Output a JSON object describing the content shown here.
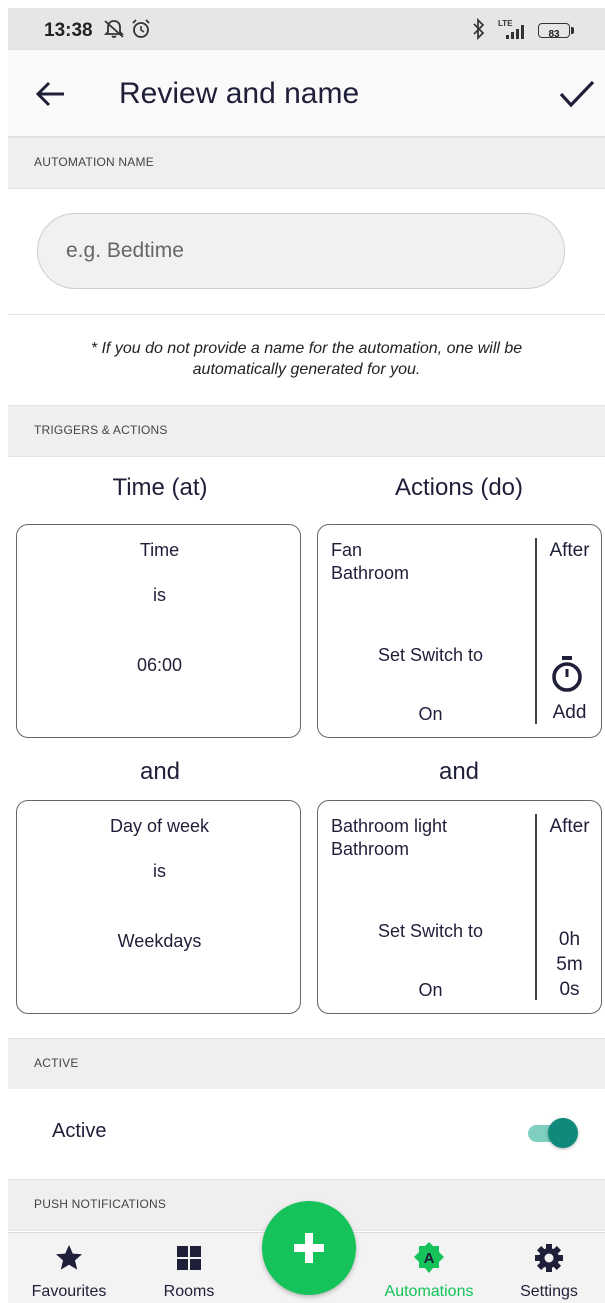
{
  "status_bar": {
    "time": "13:38",
    "network": "LTE",
    "battery": "83"
  },
  "app_bar": {
    "title": "Review and name"
  },
  "sections": {
    "automation_name": "AUTOMATION NAME",
    "triggers_actions": "TRIGGERS & ACTIONS",
    "active": "ACTIVE",
    "push_notifications": "PUSH NOTIFICATIONS"
  },
  "name_field": {
    "placeholder": "e.g. Bedtime",
    "value": ""
  },
  "note": "* If you do not provide a name for the automation, one will be automatically generated for you.",
  "columns": {
    "triggers": "Time (at)",
    "actions": "Actions (do)"
  },
  "join_word": "and",
  "triggers": [
    {
      "subject": "Time",
      "operator": "is",
      "value": "06:00"
    },
    {
      "subject": "Day of week",
      "operator": "is",
      "value": "Weekdays"
    }
  ],
  "actions": [
    {
      "device": "Fan",
      "room": "Bathroom",
      "command": "Set Switch to",
      "state": "On",
      "after_label": "After",
      "delay": [
        "Add"
      ]
    },
    {
      "device": "Bathroom light",
      "room": "Bathroom",
      "command": "Set Switch to",
      "state": "On",
      "after_label": "After",
      "delay": [
        "0h",
        "5m",
        "0s"
      ]
    }
  ],
  "active_row": {
    "label": "Active",
    "enabled": true
  },
  "colors": {
    "accent_green": "#16c35a",
    "toggle_teal": "#0f8a7a",
    "text_dark": "#1f1f3a"
  },
  "bottom_nav": [
    {
      "label": "Favourites",
      "icon": "star-icon"
    },
    {
      "label": "Rooms",
      "icon": "grid-icon"
    },
    {
      "label": "Automations",
      "icon": "automation-badge-icon",
      "badge_letter": "A",
      "selected": true
    },
    {
      "label": "Settings",
      "icon": "gear-icon"
    }
  ],
  "fab_icon": "plus-icon"
}
